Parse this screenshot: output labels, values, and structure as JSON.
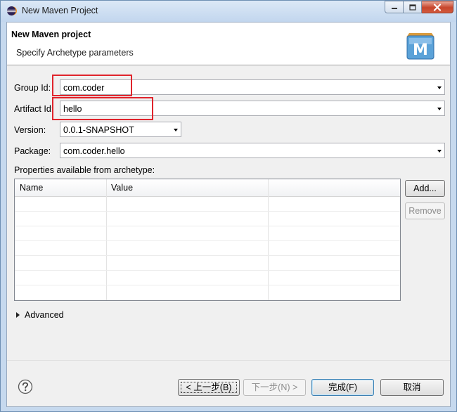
{
  "window": {
    "title": "New Maven Project"
  },
  "banner": {
    "title": "New Maven project",
    "subtitle": "Specify Archetype parameters",
    "logo_letter": "M"
  },
  "form": {
    "group_id": {
      "label": "Group Id:",
      "value": "com.coder"
    },
    "artifact_id": {
      "label": "Artifact Id:",
      "value": "hello"
    },
    "version": {
      "label": "Version:",
      "value": "0.0.1-SNAPSHOT"
    },
    "package": {
      "label": "Package:",
      "value": "com.coder.hello"
    }
  },
  "properties": {
    "label": "Properties available from archetype:",
    "columns": [
      "Name",
      "Value"
    ],
    "rows": [],
    "add_label": "Add...",
    "remove_label": "Remove"
  },
  "advanced": {
    "label": "Advanced"
  },
  "buttons": {
    "back": "< 上一步(B)",
    "next": "下一步(N) >",
    "finish": "完成(F)",
    "cancel": "取消"
  },
  "colors": {
    "highlight": "#e0242c",
    "accent": "#3c7fb1"
  }
}
